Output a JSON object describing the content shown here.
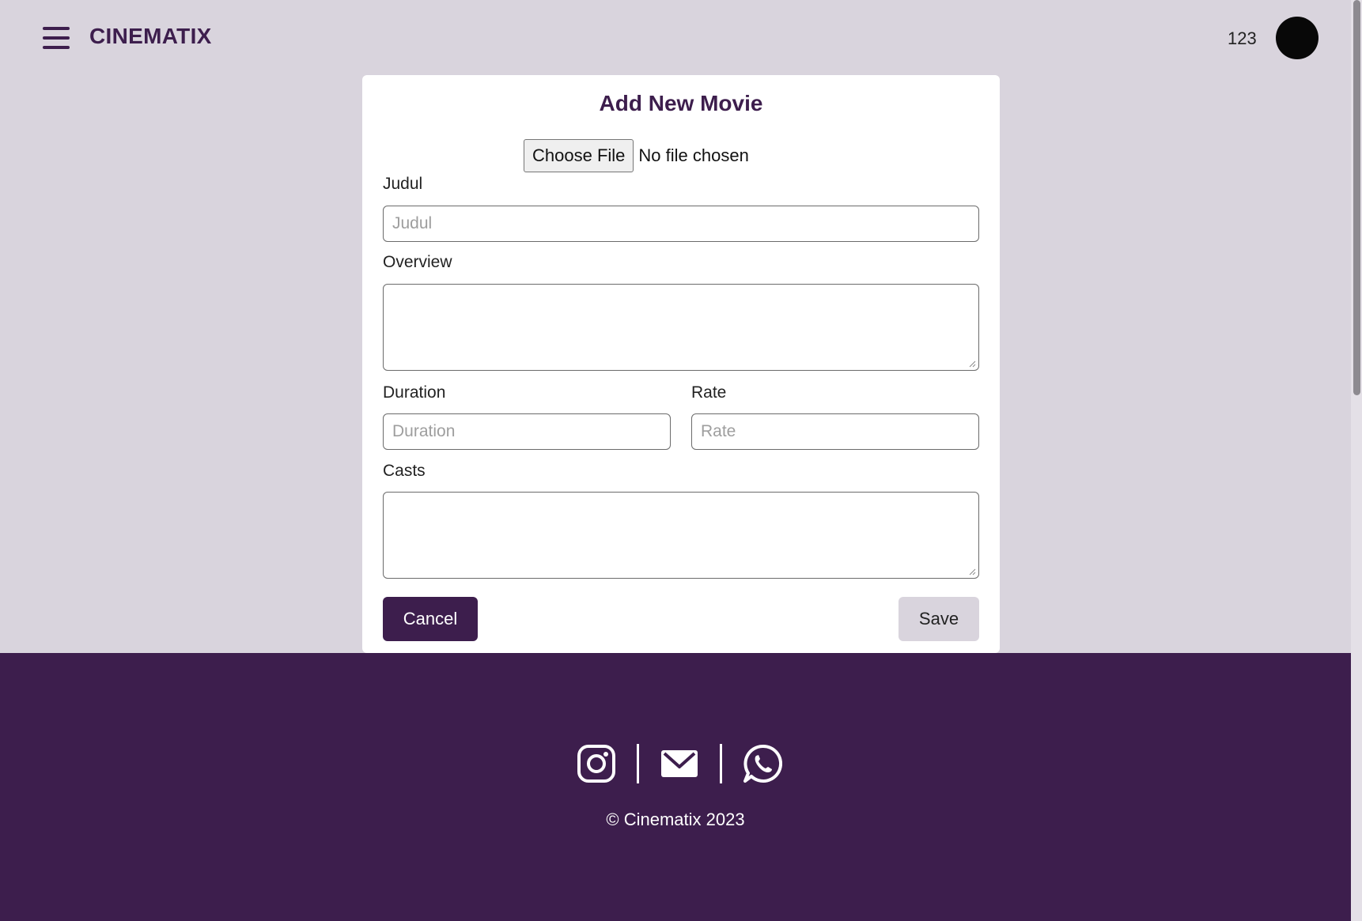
{
  "header": {
    "brand": "CINEMATIX",
    "user_id": "123"
  },
  "form": {
    "title": "Add New Movie",
    "file_button": "Choose File",
    "file_status": "No file chosen",
    "fields": {
      "judul": {
        "label": "Judul",
        "placeholder": "Judul",
        "value": ""
      },
      "overview": {
        "label": "Overview",
        "value": ""
      },
      "duration": {
        "label": "Duration",
        "placeholder": "Duration",
        "value": ""
      },
      "rate": {
        "label": "Rate",
        "placeholder": "Rate",
        "value": ""
      },
      "casts": {
        "label": "Casts",
        "value": ""
      }
    },
    "cancel_label": "Cancel",
    "save_label": "Save"
  },
  "footer": {
    "icons": [
      "instagram-icon",
      "mail-icon",
      "whatsapp-icon"
    ],
    "copyright": "© Cinematix 2023"
  },
  "colors": {
    "brand": "#3d1e4d",
    "page_bg": "#d9d4dd",
    "card_bg": "#ffffff",
    "save_bg": "#d9d4dd"
  }
}
